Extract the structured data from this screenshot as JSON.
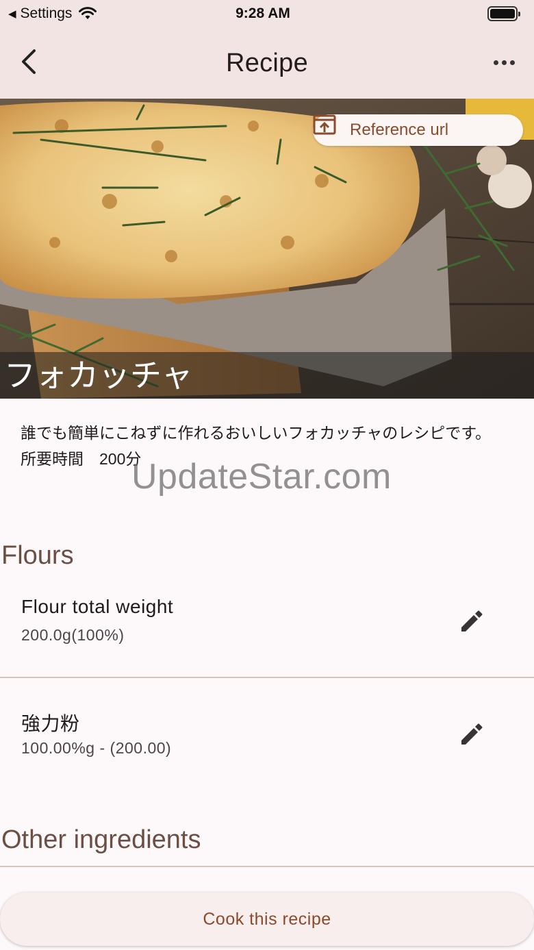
{
  "status_bar": {
    "back_app": "Settings",
    "time": "9:28 AM"
  },
  "app_bar": {
    "title": "Recipe",
    "back_icon": "chevron-left-icon",
    "menu_icon": "more-horizontal-icon"
  },
  "hero": {
    "reference_button_label": "Reference url",
    "reference_icon": "open-in-browser-icon",
    "caption": "フォカッチャ"
  },
  "description": {
    "text": "誰でも簡単にこねずに作れるおいしいフォカッチャのレシピです。",
    "time_label": "所要時間　200分"
  },
  "watermark": "UpdateStar.com",
  "sections": {
    "flours_title": "Flours",
    "other_title": "Other ingredients"
  },
  "flours": [
    {
      "title": "Flour total weight",
      "subtitle": "200.0g(100%)"
    },
    {
      "title": "強力粉",
      "subtitle": "100.00%g - (200.00)"
    }
  ],
  "cook_button_label": "Cook this recipe",
  "colors": {
    "appbar_bg": "#f2e4e2",
    "accent": "#8b4a2c",
    "section_title": "#6b4f44",
    "background": "#fdf8f9"
  }
}
